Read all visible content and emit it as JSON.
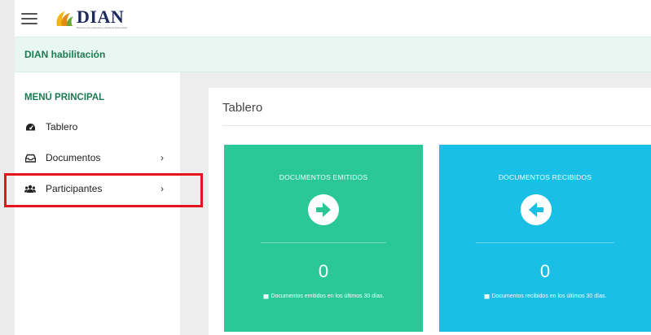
{
  "header": {
    "logo_text": "DIAN",
    "logo_subtitle": "Dirección de Impuestos y Aduanas Nacionales"
  },
  "environment": {
    "label": "DIAN habilitación"
  },
  "sidebar": {
    "title": "MENÚ PRINCIPAL",
    "items": [
      {
        "label": "Tablero",
        "icon": "dashboard-icon",
        "has_submenu": false
      },
      {
        "label": "Documentos",
        "icon": "inbox-icon",
        "has_submenu": true,
        "chevron": "›"
      },
      {
        "label": "Participantes",
        "icon": "users-icon",
        "has_submenu": true,
        "chevron": "›",
        "highlighted": true
      }
    ]
  },
  "main": {
    "title": "Tablero",
    "cards": [
      {
        "title": "DOCUMENTOS EMITIDOS",
        "icon": "arrow-right-circle-icon",
        "count": "0",
        "footer": "Documentos emitidos en los últimos 30 días.",
        "color": "#2bc897"
      },
      {
        "title": "DOCUMENTOS RECIBIDOS",
        "icon": "arrow-left-circle-icon",
        "count": "0",
        "footer": "Documentos recibidos en los últimos 30 días.",
        "color": "#19bfe4"
      }
    ]
  },
  "colors": {
    "brand_green": "#1c7a52",
    "env_bg": "#e8f7f1",
    "highlight_red": "#e8141b",
    "logo_navy": "#1f2a5c"
  }
}
